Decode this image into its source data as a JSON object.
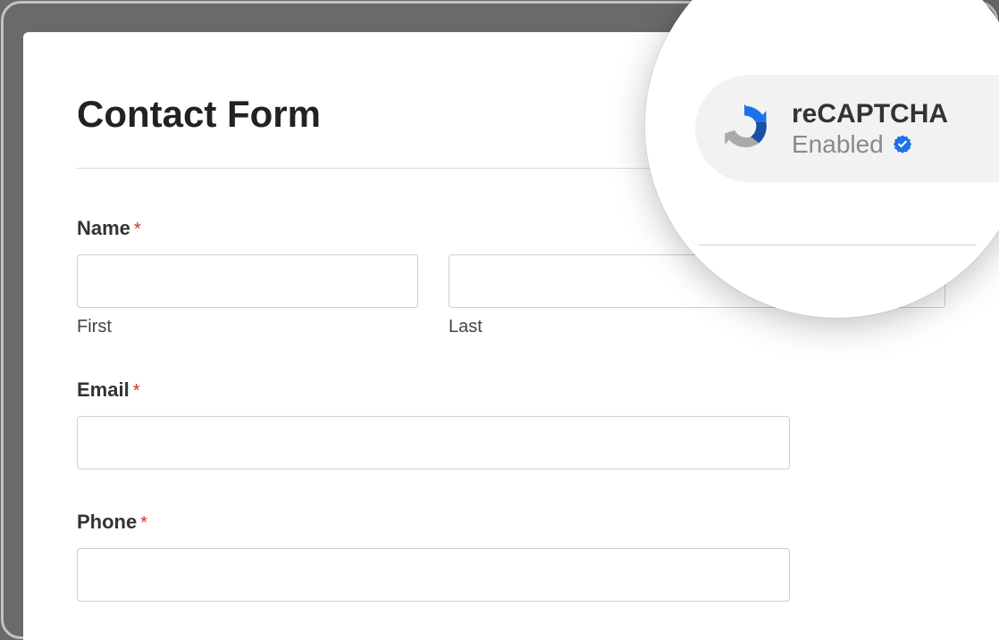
{
  "form": {
    "title": "Contact Form",
    "fields": {
      "name": {
        "label": "Name",
        "first_sublabel": "First",
        "last_sublabel": "Last"
      },
      "email": {
        "label": "Email"
      },
      "phone": {
        "label": "Phone"
      }
    }
  },
  "recaptcha": {
    "title": "reCAPTCHA",
    "status": "Enabled"
  }
}
